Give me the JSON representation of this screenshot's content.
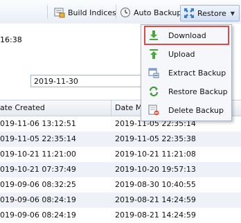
{
  "toolbar": {
    "build_indices_label": "Build Indices",
    "auto_backup_label": "Auto Backup",
    "restore_label": "Restore"
  },
  "panel": {
    "time_text": "16:38",
    "date_value": "2019-11-30"
  },
  "grid": {
    "columns": [
      "ate Created",
      "Date Mo"
    ],
    "rows": [
      [
        "019-11-06 13:12:51",
        "2019-11-05 22:35:14"
      ],
      [
        "019-11-05 22:35:14",
        "2019-11-05 22:35:38"
      ],
      [
        "019-10-21 11:21:00",
        "2019-10-21 11:21:08"
      ],
      [
        "019-10-21 07:37:49",
        "2019-10-20 19:57:13"
      ],
      [
        "019-09-06 08:32:25",
        "2019-08-30 10:40:55"
      ],
      [
        "019-09-06 08:24:19",
        "2019-08-21 14:24:59"
      ],
      [
        "019-09-06 08:24:19",
        "2019-08-21 14:24:59"
      ]
    ]
  },
  "menu": {
    "items": [
      {
        "label": "Download",
        "icon": "download-icon"
      },
      {
        "label": "Upload",
        "icon": "upload-icon"
      },
      {
        "label": "Extract Backup",
        "icon": "extract-icon"
      },
      {
        "label": "Restore Backup",
        "icon": "restore-icon"
      },
      {
        "label": "Delete Backup",
        "icon": "delete-icon"
      }
    ]
  },
  "colors": {
    "highlight": "#e04848",
    "toolbar_border": "#c9d3e2",
    "alt_row": "#eef1f7"
  }
}
